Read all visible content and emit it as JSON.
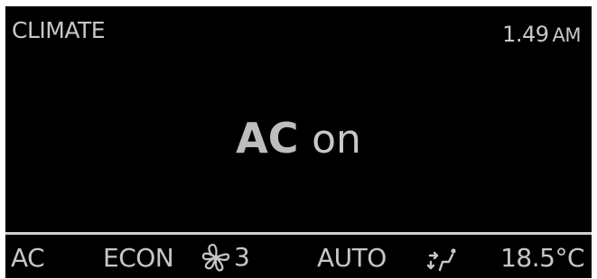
{
  "header": {
    "title": "CLIMATE",
    "time": "1.49",
    "ampm": "AM"
  },
  "main": {
    "status_strong": "AC",
    "status_weak": "on"
  },
  "footer": {
    "ac": "AC",
    "econ": "ECON",
    "fan_icon": "fan-icon",
    "fan_speed": "3",
    "auto": "AUTO",
    "airflow_icon": "airflow-mode-icon",
    "temperature": "18.5°C"
  },
  "colors": {
    "background": "#000000",
    "text": "#c7c7c7",
    "divider": "#cfcfcf"
  }
}
